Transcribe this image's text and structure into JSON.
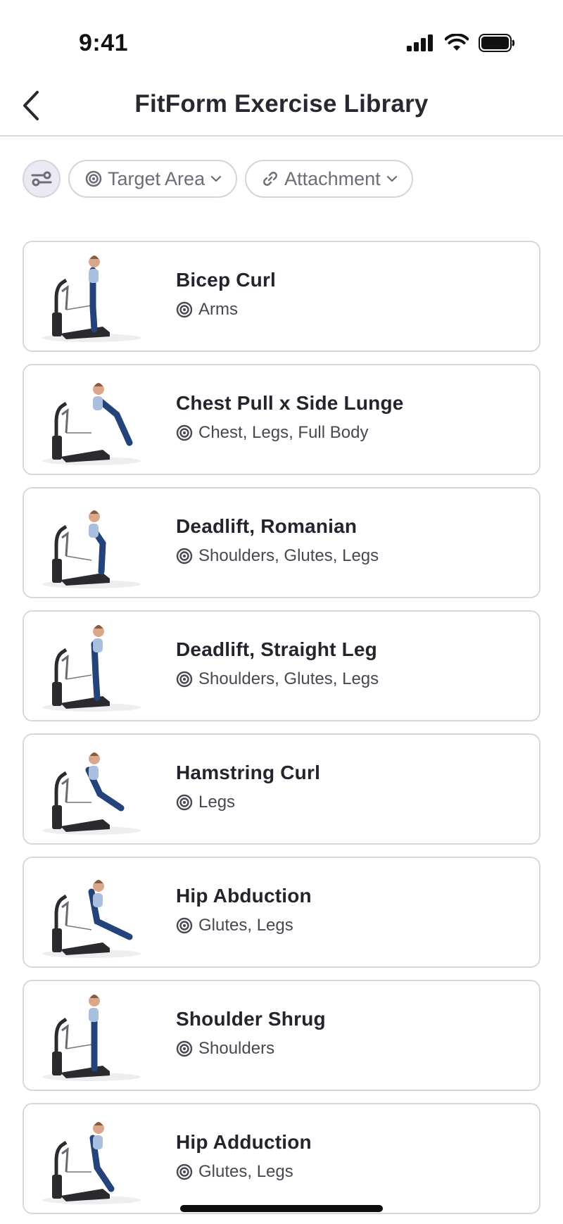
{
  "status_bar": {
    "time": "9:41"
  },
  "header": {
    "title": "FitForm Exercise Library"
  },
  "filters": {
    "target_area_label": "Target Area",
    "attachment_label": "Attachment"
  },
  "exercises": [
    {
      "name": "Bicep Curl",
      "targets": "Arms"
    },
    {
      "name": "Chest Pull x Side Lunge",
      "targets": "Chest, Legs, Full Body"
    },
    {
      "name": "Deadlift, Romanian",
      "targets": "Shoulders, Glutes, Legs"
    },
    {
      "name": "Deadlift, Straight Leg",
      "targets": "Shoulders, Glutes, Legs"
    },
    {
      "name": "Hamstring Curl",
      "targets": "Legs"
    },
    {
      "name": "Hip Abduction",
      "targets": "Glutes, Legs"
    },
    {
      "name": "Shoulder Shrug",
      "targets": "Shoulders"
    },
    {
      "name": "Hip Adduction",
      "targets": "Glutes, Legs"
    }
  ],
  "colors": {
    "title": "#2a2733",
    "chip_border": "#d4d3df",
    "settings_bg": "#ebeaf3",
    "card_border": "#d7d6df",
    "outfit_top": "#a9bfe0",
    "outfit_leggings": "#24437a",
    "machine": "#2b2b2f"
  },
  "icons": {
    "back": "chevron-left-icon",
    "filter_settings": "sliders-icon",
    "target": "target-icon",
    "attachment": "link-icon",
    "dropdown": "chevron-down-icon"
  }
}
